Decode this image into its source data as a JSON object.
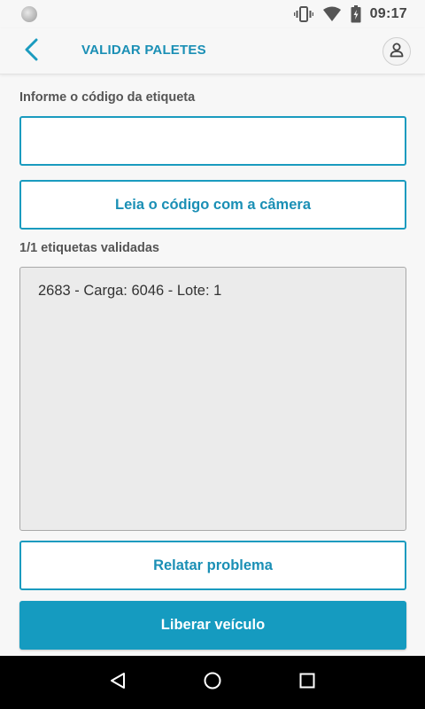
{
  "status_bar": {
    "time": "09:17",
    "icons": [
      "notification-dot-icon",
      "vibrate-icon",
      "wifi-icon",
      "battery-charging-icon"
    ]
  },
  "app_bar": {
    "title": "VALIDAR PALETES",
    "back_icon": "chevron-left-icon",
    "profile_icon": "user-icon"
  },
  "form": {
    "code_label": "Informe o código da etiqueta",
    "code_value": "",
    "code_placeholder": "",
    "camera_button_label": "Leia o código com a câmera"
  },
  "validated": {
    "count_label": "1/1 etiquetas validadas",
    "items": [
      "2683 - Carga: 6046 - Lote: 1"
    ]
  },
  "actions": {
    "report_problem_label": "Relatar problema",
    "release_vehicle_label": "Liberar veículo"
  },
  "nav_bar": {
    "icons": [
      "back-triangle-icon",
      "home-circle-icon",
      "recents-square-icon"
    ]
  },
  "colors": {
    "accent": "#1a9bbf",
    "primary_button": "#159bc0",
    "background": "#f7f7f7",
    "list_background": "#ebebeb"
  }
}
